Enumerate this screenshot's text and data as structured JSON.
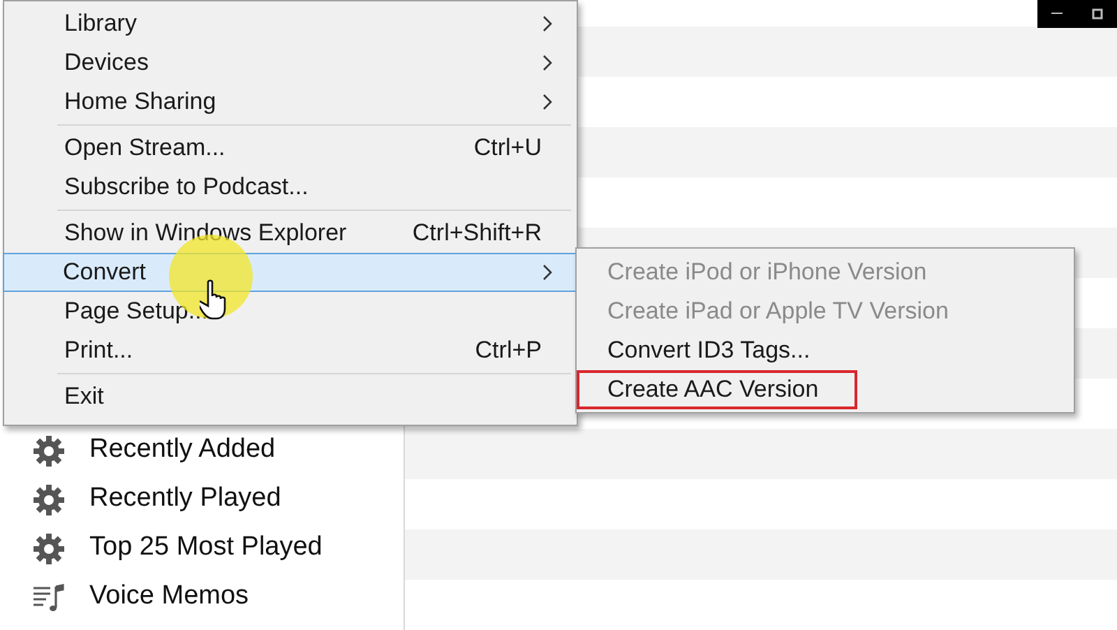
{
  "window_controls": [
    {
      "kind": "minimize"
    },
    {
      "kind": "restore"
    }
  ],
  "sidebar": {
    "items": [
      {
        "label": "Recently Added",
        "kind": "smart"
      },
      {
        "label": "Recently Played",
        "kind": "smart"
      },
      {
        "label": "Top 25 Most Played",
        "kind": "smart"
      },
      {
        "label": "Voice Memos",
        "kind": "playlist"
      }
    ]
  },
  "file_menu": {
    "items": [
      {
        "kind": "item",
        "label": "Library",
        "submenu": true,
        "selected": false
      },
      {
        "kind": "item",
        "label": "Devices",
        "submenu": true,
        "selected": false
      },
      {
        "kind": "item",
        "label": "Home Sharing",
        "submenu": true,
        "selected": false
      },
      {
        "kind": "separator"
      },
      {
        "kind": "item",
        "label": "Open Stream...",
        "shortcut": "Ctrl+U",
        "selected": false
      },
      {
        "kind": "item",
        "label": "Subscribe to Podcast...",
        "selected": false
      },
      {
        "kind": "separator"
      },
      {
        "kind": "item",
        "label": "Show in Windows Explorer",
        "shortcut": "Ctrl+Shift+R",
        "selected": false
      },
      {
        "kind": "item",
        "label": "Convert",
        "submenu": true,
        "selected": true
      },
      {
        "kind": "item",
        "label": "Page Setup...",
        "selected": false
      },
      {
        "kind": "item",
        "label": "Print...",
        "shortcut": "Ctrl+P",
        "selected": false
      },
      {
        "kind": "separator"
      },
      {
        "kind": "item",
        "label": "Exit",
        "selected": false
      }
    ]
  },
  "convert_submenu": {
    "items": [
      {
        "label": "Create iPod or iPhone Version",
        "disabled": true,
        "outlined": false
      },
      {
        "label": "Create iPad or Apple TV Version",
        "disabled": true,
        "outlined": false
      },
      {
        "label": "Convert ID3 Tags...",
        "disabled": false,
        "outlined": false
      },
      {
        "label": "Create AAC Version",
        "disabled": false,
        "outlined": true
      }
    ]
  }
}
